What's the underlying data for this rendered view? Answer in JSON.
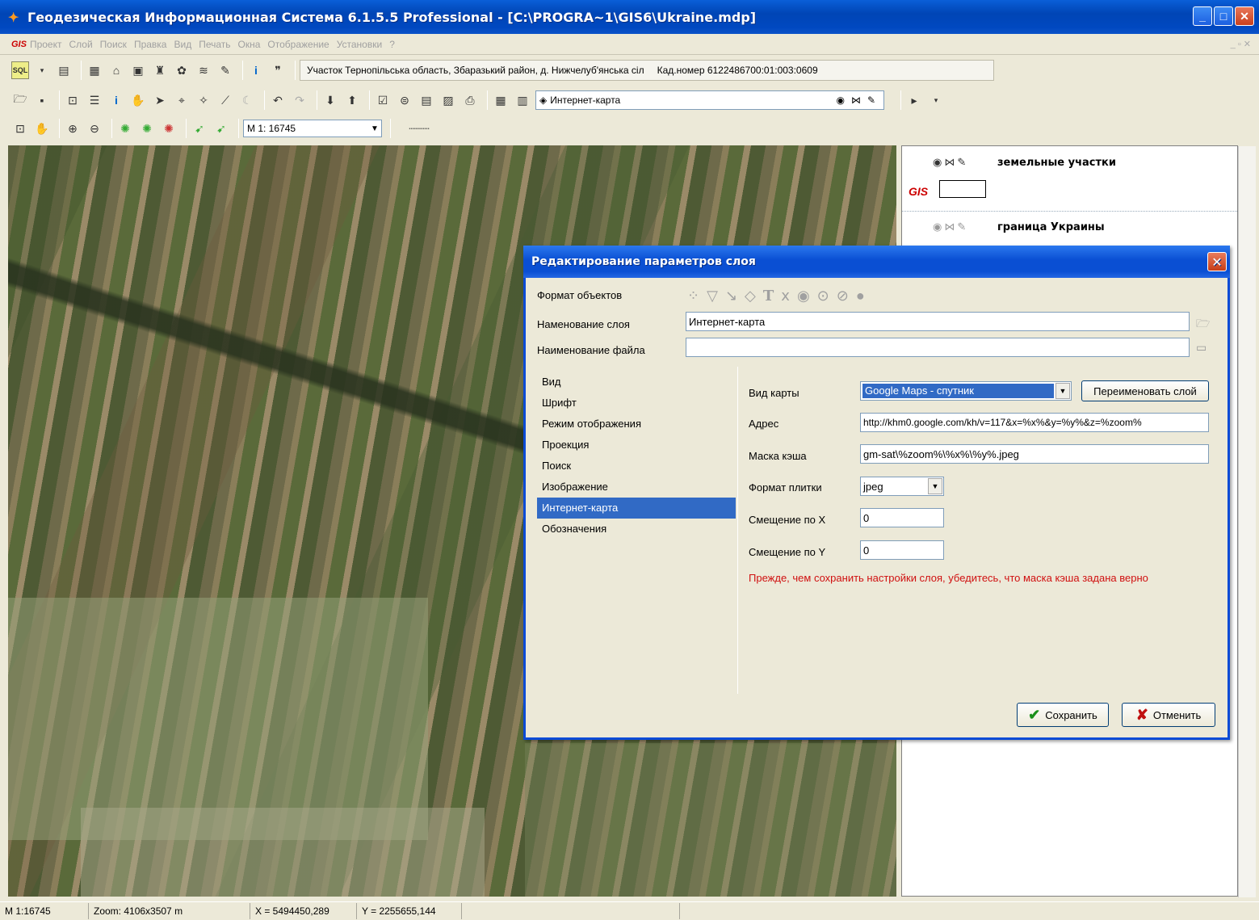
{
  "window": {
    "title": "Геодезическая Информационная Система 6.1.5.5 Professional - [C:\\PROGRA~1\\GIS6\\Ukraine.mdp]"
  },
  "menu": {
    "logo": "GIS",
    "items": [
      "Проект",
      "Слой",
      "Поиск",
      "Правка",
      "Вид",
      "Печать",
      "Окна",
      "Отображение",
      "Установки",
      "?"
    ]
  },
  "toolbar1": {
    "sql_label": "SQL",
    "parcel_info": "Участок  Тернопільська область, Збаразький район, д. Нижчелуб'янська сіл",
    "cadastral_info": "Кад.номер  6122486700:01:003:0609"
  },
  "toolbar2": {
    "layer_combo": "Интернет-карта"
  },
  "toolbar3": {
    "scale_combo": "M 1: 16745"
  },
  "layers_panel": {
    "layers": [
      {
        "name": "земельные участки"
      },
      {
        "name": "граница Украины"
      }
    ]
  },
  "dialog": {
    "title": "Редактирование параметров слоя",
    "object_format_label": "Формат объектов",
    "layer_name_label": "Наменование слоя",
    "layer_name_value": "Интернет-карта",
    "file_name_label": "Наименование файла",
    "file_name_value": "",
    "categories": [
      "Вид",
      "Шрифт",
      "Режим отображения",
      "Проекция",
      "Поиск",
      "Изображение",
      "Интернет-карта",
      "Обозначения"
    ],
    "selected_category": "Интернет-карта",
    "map_type_label": "Вид карты",
    "map_type_value": "Google Maps - спутник",
    "rename_button": "Переименовать слой",
    "address_label": "Адрес",
    "address_value": "http://khm0.google.com/kh/v=117&x=%x%&y=%y%&z=%zoom%",
    "cache_mask_label": "Маска кэша",
    "cache_mask_value": "gm-sat\\%zoom%\\%x%\\%y%.jpeg",
    "tile_format_label": "Формат плитки",
    "tile_format_value": "jpeg",
    "offset_x_label": "Смещение по X",
    "offset_x_value": "0",
    "offset_y_label": "Смещение по Y",
    "offset_y_value": "0",
    "warning": "Прежде, чем сохранить настройки слоя, убедитесь, что маска кэша задана верно",
    "save_button": "Сохранить",
    "cancel_button": "Отменить"
  },
  "statusbar": {
    "scale": "M 1:16745",
    "zoom": "Zoom: 4106x3507 m",
    "x": "X = 5494450,289",
    "y": "Y = 2255655,144"
  },
  "colors": {
    "titlebar": "#0a52c8",
    "selection": "#316ac5",
    "warning": "#d01010",
    "background": "#ece9d8"
  }
}
